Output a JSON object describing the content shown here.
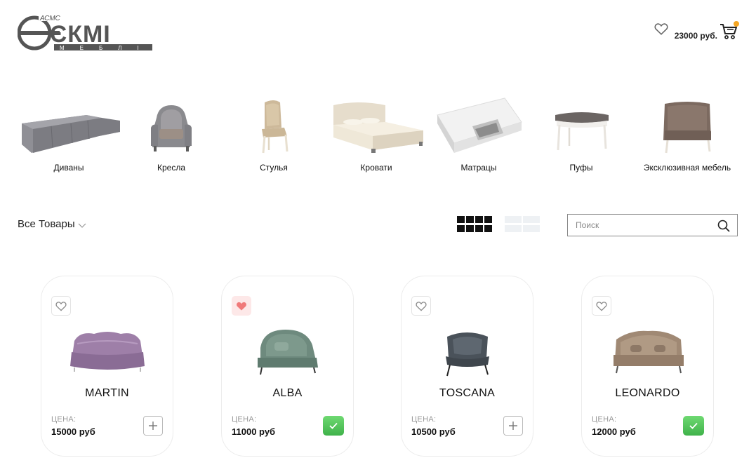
{
  "header": {
    "logo_text": "ЄКМІ",
    "logo_sub": "МЕБЛІ",
    "logo_badge": "АСМС",
    "wishlist_icon": "heart-outline-icon",
    "cart_total": "23000 руб.",
    "cart_icon": "shopping-cart-icon",
    "cart_dot_color": "#f5a623"
  },
  "categories": [
    {
      "label": "Диваны",
      "icon": "sofa-image"
    },
    {
      "label": "Кресла",
      "icon": "armchair-image"
    },
    {
      "label": "Стулья",
      "icon": "chair-image"
    },
    {
      "label": "Кровати",
      "icon": "bed-image"
    },
    {
      "label": "Матрацы",
      "icon": "mattress-image"
    },
    {
      "label": "Пуфы",
      "icon": "ottoman-image"
    },
    {
      "label": "Эксклюзивная мебель",
      "icon": "exclusive-sofa-image"
    }
  ],
  "toolbar": {
    "filter_label": "Все Товары",
    "filter_icon": "chevron-down-icon",
    "grid_view_icon": "grid-view-icon",
    "list_view_icon": "list-view-icon",
    "search_placeholder": "Поиск",
    "search_icon": "search-icon"
  },
  "products": [
    {
      "name": "MARTIN",
      "price_label": "ЦЕНА:",
      "price": "15000 руб",
      "favorite": false,
      "in_cart": false
    },
    {
      "name": "ALBA",
      "price_label": "ЦЕНА:",
      "price": "11000 руб",
      "favorite": true,
      "in_cart": true
    },
    {
      "name": "TOSCANA",
      "price_label": "ЦЕНА:",
      "price": "10500 руб",
      "favorite": false,
      "in_cart": false
    },
    {
      "name": "LEONARDO",
      "price_label": "ЦЕНА:",
      "price": "12000 руб",
      "favorite": false,
      "in_cart": true
    }
  ],
  "colors": {
    "favorite_active": "#f07a7a",
    "in_cart_green": "#4cc354",
    "text": "#222222"
  }
}
